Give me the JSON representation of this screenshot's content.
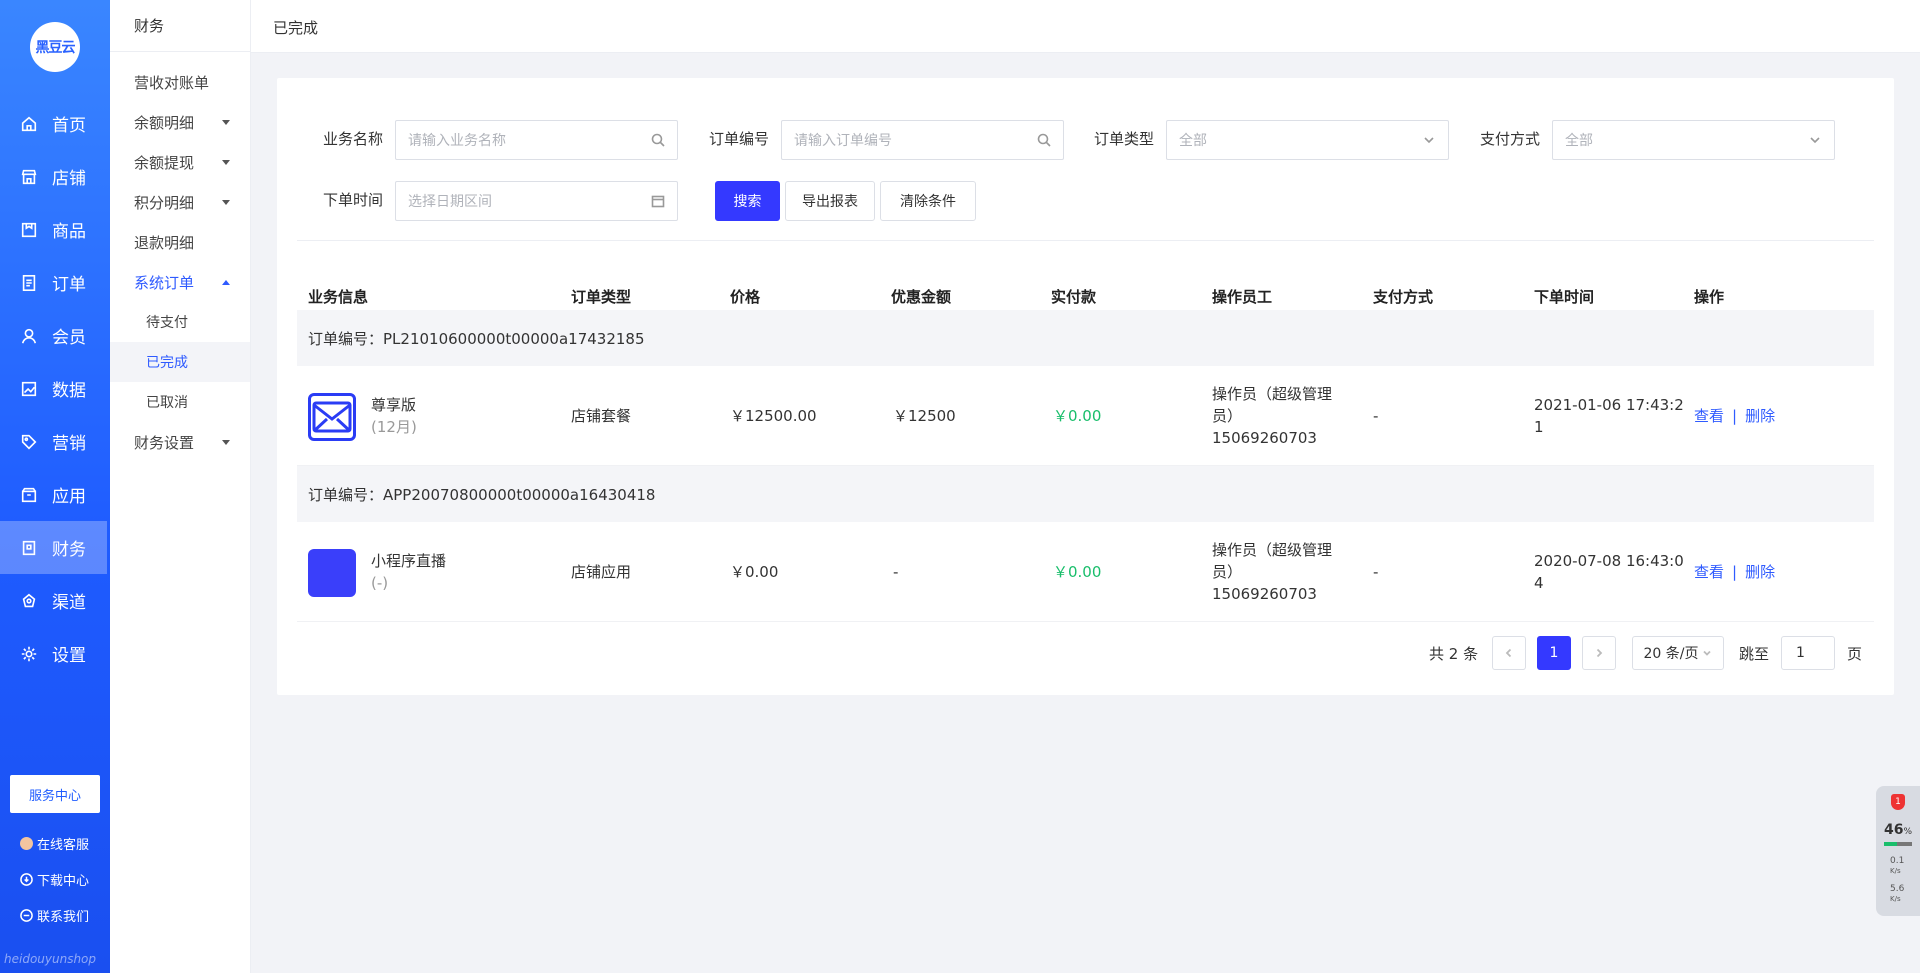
{
  "brand": {
    "logo_text": "黑豆云",
    "footer": "heidouyunshop"
  },
  "nav": {
    "items": [
      {
        "label": "首页",
        "icon": "home-icon"
      },
      {
        "label": "店铺",
        "icon": "store-icon"
      },
      {
        "label": "商品",
        "icon": "goods-icon"
      },
      {
        "label": "订单",
        "icon": "order-icon"
      },
      {
        "label": "会员",
        "icon": "member-icon"
      },
      {
        "label": "数据",
        "icon": "chart-icon"
      },
      {
        "label": "营销",
        "icon": "tag-icon"
      },
      {
        "label": "应用",
        "icon": "app-icon"
      },
      {
        "label": "财务",
        "icon": "finance-icon"
      },
      {
        "label": "渠道",
        "icon": "channel-icon"
      },
      {
        "label": "设置",
        "icon": "gear-icon"
      }
    ],
    "service_center": "服务中心",
    "links": [
      "在线客服",
      "下载中心",
      "联系我们"
    ]
  },
  "subnav": {
    "title": "财务",
    "items": {
      "reconcile": "营收对账单",
      "balance_detail": "余额明细",
      "balance_withdraw": "余额提现",
      "points_detail": "积分明细",
      "refund_detail": "退款明细",
      "system_order": "系统订单",
      "pending": "待支付",
      "completed": "已完成",
      "cancelled": "已取消",
      "finance_settings": "财务设置"
    }
  },
  "topbar": {
    "crumb": "已完成"
  },
  "filters": {
    "biz_name_label": "业务名称",
    "biz_name_placeholder": "请输入业务名称",
    "order_no_label": "订单编号",
    "order_no_placeholder": "请输入订单编号",
    "order_type_label": "订单类型",
    "order_type_value": "全部",
    "pay_method_label": "支付方式",
    "pay_method_value": "全部",
    "order_time_label": "下单时间",
    "order_time_placeholder": "选择日期区间",
    "search_btn": "搜索",
    "export_btn": "导出报表",
    "clear_btn": "清除条件"
  },
  "table": {
    "headers": [
      "业务信息",
      "订单类型",
      "价格",
      "优惠金额",
      "实付款",
      "操作员工",
      "支付方式",
      "下单时间",
      "操作"
    ],
    "groups": [
      {
        "order_no": "订单编号：PL21010600000t00000a17432185",
        "name": "尊享版",
        "sub": "(12月)",
        "type": "店铺套餐",
        "price": "￥12500.00",
        "discount": "￥12500",
        "paid": "￥0.00",
        "operator_1": "操作员（超级管理",
        "operator_2": "员）",
        "operator_3": "15069260703",
        "pay_method": "-",
        "time_1": "2021-01-06 17:43:2",
        "time_2": "1",
        "view": "查看",
        "delete": "删除"
      },
      {
        "order_no": "订单编号：APP20070800000t00000a16430418",
        "name": "小程序直播",
        "sub": "(-)",
        "type": "店铺应用",
        "price": "￥0.00",
        "discount": "-",
        "paid": "￥0.00",
        "operator_1": "操作员（超级管理",
        "operator_2": "员）",
        "operator_3": "15069260703",
        "pay_method": "-",
        "time_1": "2020-07-08 16:43:0",
        "time_2": "4",
        "view": "查看",
        "delete": "删除"
      }
    ],
    "divider": "|"
  },
  "pager": {
    "total": "共 2 条",
    "current_page": "1",
    "page_size": "20 条/页",
    "jump_label": "跳至",
    "jump_value": "1",
    "page_unit": "页"
  },
  "widget": {
    "badge": "1",
    "percent": "46",
    "percent_sign": "%",
    "up": "0.1",
    "down": "5.6",
    "unit": "K/s",
    "load": 0.46
  },
  "colors": {
    "primary": "#3439ff",
    "sidebar": "#1f5cff",
    "paid_green": "#19be6b"
  }
}
